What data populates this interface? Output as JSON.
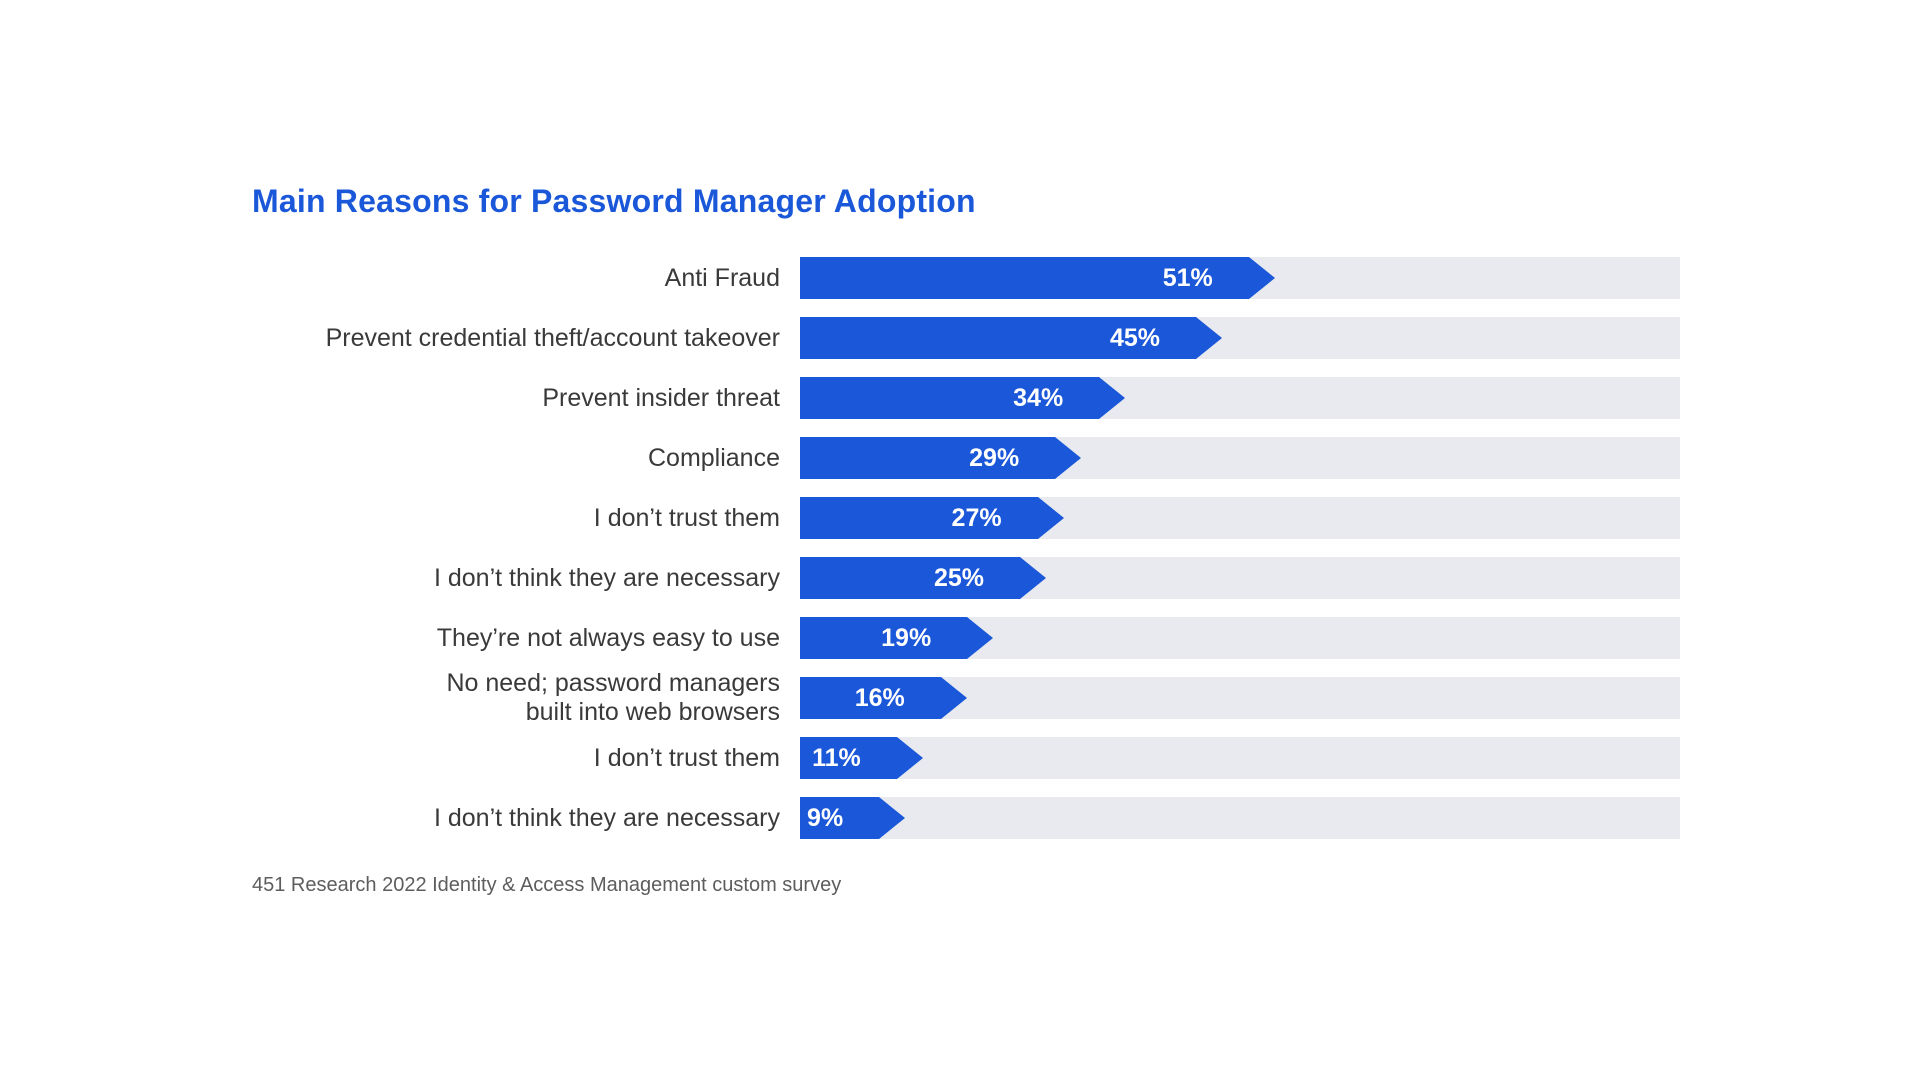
{
  "colors": {
    "accent": "#1A57D9",
    "track": "#e8eaef",
    "text": "#3a3a3a",
    "footnote": "#5d5d5d",
    "value_text": "#ffffff"
  },
  "chart_data": {
    "type": "bar",
    "title": "Main Reasons for Password Manager Adoption",
    "xlabel": "",
    "ylabel": "",
    "xlim": [
      0,
      100
    ],
    "categories": [
      "Anti Fraud",
      "Prevent credential theft/account takeover",
      "Prevent insider threat",
      "Compliance",
      "I don’t trust them",
      "I don’t think they are necessary",
      "They’re not always easy to use",
      "No need; password managers built into web browsers",
      "I don’t trust them",
      "I don’t think they are necessary"
    ],
    "values": [
      51,
      45,
      34,
      29,
      27,
      25,
      19,
      16,
      11,
      9
    ],
    "value_labels": [
      "51%",
      "45%",
      "34%",
      "29%",
      "27%",
      "25%",
      "19%",
      "16%",
      "11%",
      "9%"
    ],
    "multiline_label_idx": [
      7
    ]
  },
  "footnote": "451 Research 2022 Identity & Access Management custom survey"
}
